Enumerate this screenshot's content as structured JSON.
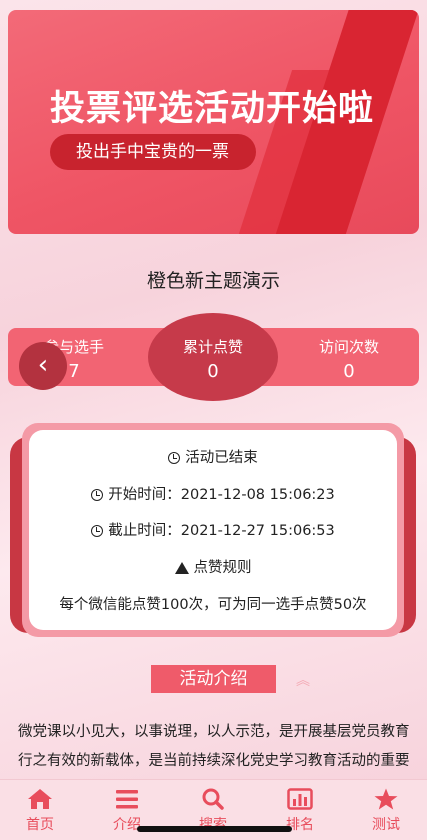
{
  "banner": {
    "title": "投票评选活动开始啦",
    "subtitle": "投出手中宝贵的一票"
  },
  "theme_title": "橙色新主题演示",
  "stats": {
    "participants": {
      "label": "参与选手",
      "value": "7"
    },
    "likes": {
      "label": "累计点赞",
      "value": "0"
    },
    "visits": {
      "label": "访问次数",
      "value": "0"
    }
  },
  "info_card": {
    "status": "活动已结束",
    "start_label": "开始时间：",
    "start_time": "2021-12-08 15:06:23",
    "end_label": "截止时间：",
    "end_time": "2021-12-27 15:06:53",
    "rules_title": "点赞规则",
    "rules_text": "每个微信能点赞100次，可为同一选手点赞50次"
  },
  "intro": {
    "heading": "活动介绍",
    "text": "微党课以小见大，以事说理，以人示范，是开展基层党员教育行之有效的新载体，是当前持续深化党史学习教育活动的重要形式。据悉，党员学习教育持续推进，发挥党员"
  },
  "tabs": [
    {
      "label": "首页",
      "icon": "home-icon"
    },
    {
      "label": "介绍",
      "icon": "menu-icon"
    },
    {
      "label": "搜索",
      "icon": "search-icon"
    },
    {
      "label": "排名",
      "icon": "bar-chart-icon"
    },
    {
      "label": "测试",
      "icon": "star-icon"
    }
  ],
  "colors": {
    "accent": "#ef5b6a",
    "dark_accent": "#c83743",
    "tab_icon": "#e84d5c"
  }
}
